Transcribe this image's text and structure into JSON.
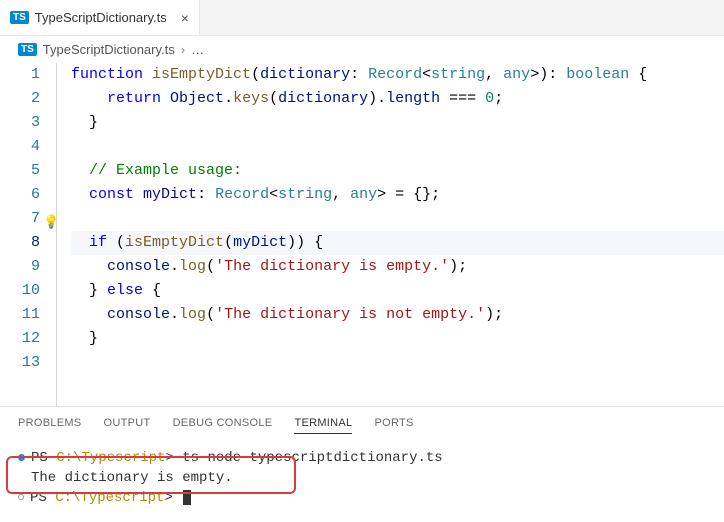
{
  "tab": {
    "filename": "TypeScriptDictionary.ts",
    "badge": "TS"
  },
  "breadcrumb": {
    "badge": "TS",
    "filename": "TypeScriptDictionary.ts",
    "ellipsis": "…"
  },
  "lines": [
    "1",
    "2",
    "3",
    "4",
    "5",
    "6",
    "7",
    "8",
    "9",
    "10",
    "11",
    "12",
    "13"
  ],
  "active_line": "8",
  "code": {
    "l1": {
      "kw1": "function",
      "fn": "isEmptyDict",
      "p1": "(",
      "id": "dictionary",
      "colon": ": ",
      "type": "Record",
      "lt": "<",
      "g1": "string",
      "comma": ", ",
      "g2": "any",
      "gt": ">",
      "p2": "): ",
      "ret": "boolean",
      "brace": " {"
    },
    "l2": {
      "kw": "return",
      "sp": " ",
      "obj": "Object",
      "dot1": ".",
      "keys": "keys",
      "p1": "(",
      "id": "dictionary",
      "p2": ").",
      "len": "length",
      "eq": " === ",
      "zero": "0",
      "semi": ";"
    },
    "l3": {
      "brace": "}"
    },
    "l4": {
      "blank": ""
    },
    "l5": {
      "comment": "// Example usage:"
    },
    "l6": {
      "kw": "const",
      "sp": " ",
      "id": "myDict",
      "colon": ": ",
      "type": "Record",
      "lt": "<",
      "g1": "string",
      "comma": ", ",
      "g2": "any",
      "gt": "> = {};"
    },
    "l7": {
      "blank": ""
    },
    "l8": {
      "kw": "if",
      "sp": " (",
      "fn": "isEmptyDict",
      "p1": "(",
      "id": "myDict",
      "p2": ")) {"
    },
    "l9": {
      "obj": "console",
      "dot": ".",
      "log": "log",
      "p1": "(",
      "str": "'The dictionary is empty.'",
      "p2": ");"
    },
    "l10": {
      "brace": "} ",
      "kw": "else",
      "brace2": " {"
    },
    "l11": {
      "obj": "console",
      "dot": ".",
      "log": "log",
      "p1": "(",
      "str": "'The dictionary is not empty.'",
      "p2": ");"
    },
    "l12": {
      "brace": "}"
    },
    "l13": {
      "blank": ""
    }
  },
  "panel": {
    "tabs": {
      "problems": "PROBLEMS",
      "output": "OUTPUT",
      "debug": "DEBUG CONSOLE",
      "terminal": "TERMINAL",
      "ports": "PORTS"
    },
    "active": "terminal"
  },
  "terminal": {
    "line1_prompt": "PS ",
    "line1_path": "C:\\Typescript",
    "line1_gt": "> ",
    "line1_cmd": "ts-node typescriptdictionary.ts",
    "line2": "The dictionary is empty.",
    "line3_prompt": "PS ",
    "line3_path": "C:\\Typescript",
    "line3_gt": "> "
  }
}
